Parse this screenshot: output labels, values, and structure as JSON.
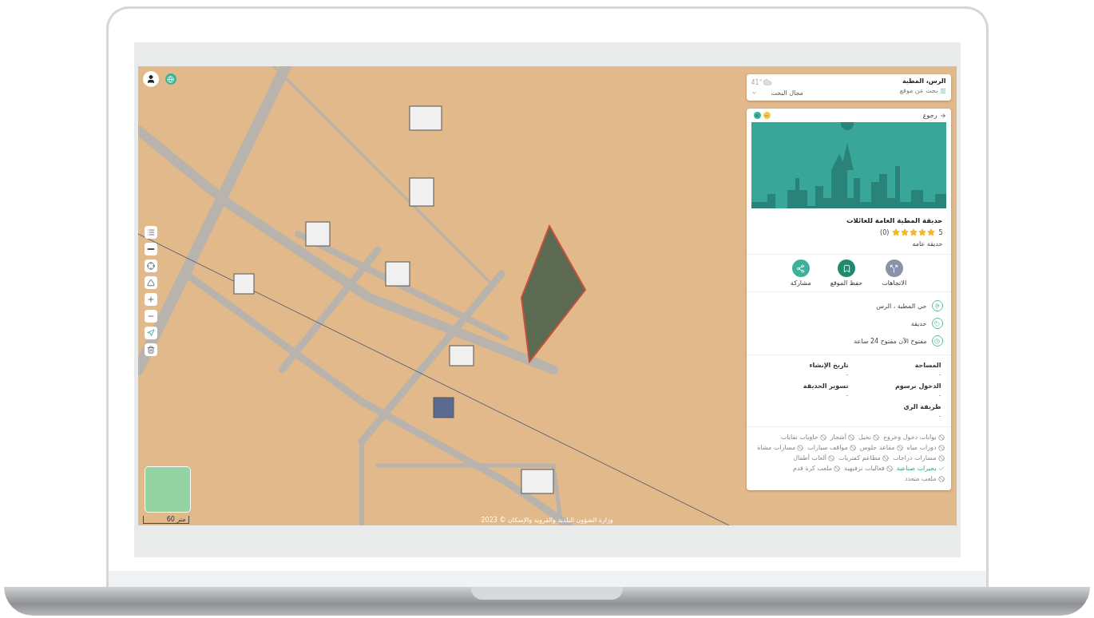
{
  "search_bar": {
    "title": "الرس، المطية",
    "search_link": "بحث عن موقع",
    "scope_dropdown": "مجال البحث",
    "temperature": "41°"
  },
  "place_card": {
    "back": "رجوع",
    "name": "حديقة المطية العامة للعائلات",
    "rating": "5",
    "stars": 5,
    "reviews": "(0)",
    "category": "حديقة عامه",
    "actions": [
      {
        "label": "الاتجاهات",
        "kind": "directions",
        "color": "#8a93a8"
      },
      {
        "label": "حفظ الموقع",
        "kind": "save",
        "color": "#1f8a6e"
      },
      {
        "label": "مشاركة",
        "kind": "share",
        "color": "#3bb39a"
      }
    ],
    "details": [
      {
        "kind": "address",
        "text": "حي المطية ، الرس"
      },
      {
        "kind": "type",
        "text": "حديقة"
      },
      {
        "kind": "hours",
        "text": "مفتوح الآن مفتوح 24 ساعة"
      }
    ],
    "attributes": [
      {
        "label": "المساحة",
        "value": "-"
      },
      {
        "label": "تاريخ الإنشاء",
        "value": "-"
      },
      {
        "label": "الدخول برسوم",
        "value": "-"
      },
      {
        "label": "تسوير الحديقة",
        "value": "-"
      },
      {
        "label": "طريقة الري",
        "value": "-"
      }
    ],
    "amenities": [
      {
        "label": "بوابات دخول وخروج",
        "available": false
      },
      {
        "label": "نخيل",
        "available": false
      },
      {
        "label": "أشجار",
        "available": false
      },
      {
        "label": "حاويات نفايات",
        "available": false
      },
      {
        "label": "دورات مياه",
        "available": false
      },
      {
        "label": "مقاعد جلوس",
        "available": false
      },
      {
        "label": "مواقف سيارات",
        "available": false
      },
      {
        "label": "مسارات مشاة",
        "available": false
      },
      {
        "label": "مسارات دراجات",
        "available": false
      },
      {
        "label": "مطاعم كفتريات",
        "available": false
      },
      {
        "label": "ألعاب أطفال",
        "available": false
      },
      {
        "label": "بحيرات صناعية",
        "available": true
      },
      {
        "label": "فعاليات ترفيهية",
        "available": false
      },
      {
        "label": "ملعب كرة قدم",
        "available": false
      },
      {
        "label": "ملعب متعدد",
        "available": false
      }
    ]
  },
  "map": {
    "scale": "60 متر",
    "attribution": "وزارة الشؤون البلدية والقروية والإسكان © 2023"
  }
}
